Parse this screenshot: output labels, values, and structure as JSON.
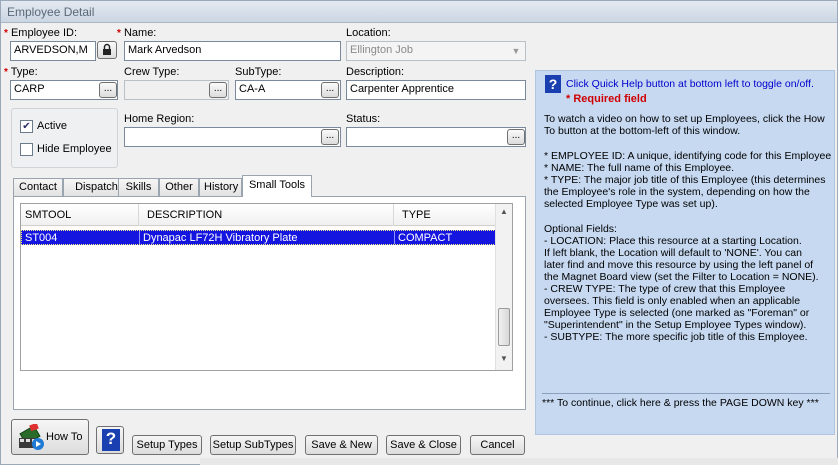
{
  "window": {
    "title": "Employee Detail"
  },
  "form": {
    "employee_id": {
      "label": "Employee ID:",
      "value": "ARVEDSON,M"
    },
    "name": {
      "label": "Name:",
      "value": "Mark Arvedson"
    },
    "location": {
      "label": "Location:",
      "value": "Ellington Job"
    },
    "type": {
      "label": "Type:",
      "value": "CARP"
    },
    "crew_type": {
      "label": "Crew Type:",
      "value": ""
    },
    "subtype": {
      "label": "SubType:",
      "value": "CA-A"
    },
    "description": {
      "label": "Description:",
      "value": "Carpenter Apprentice"
    },
    "home_region": {
      "label": "Home Region:",
      "value": ""
    },
    "status": {
      "label": "Status:",
      "value": ""
    },
    "active": {
      "label": "Active",
      "checked": true
    },
    "hide_employee": {
      "label": "Hide Employee",
      "checked": false
    },
    "required_marker": "*",
    "ellipsis_label": "..."
  },
  "tabs": [
    {
      "label": "Contact"
    },
    {
      "label": "Dispatch"
    },
    {
      "label": "Skills"
    },
    {
      "label": "Other"
    },
    {
      "label": "History"
    },
    {
      "label": "Small Tools",
      "active": true
    }
  ],
  "small_tools": {
    "columns": [
      "SMTOOL",
      "DESCRIPTION",
      "TYPE"
    ],
    "rows": [
      {
        "smtool": "ST004",
        "description": "Dynapac LF72H Vibratory Plate",
        "type": "COMPACT",
        "selected": true
      }
    ]
  },
  "help": {
    "lines": [
      "Click Quick Help button at bottom left to toggle on/off.",
      "*  Required field",
      "To watch a video on how to set up Employees, click the How",
      "To button at the bottom-left of this window.",
      "* EMPLOYEE ID: A unique, identifying code for this Employee",
      "* NAME: The full name of this Employee.",
      "* TYPE: The major job title of this Employee (this determines",
      "   the Employee's role in the system, depending on how the",
      "   selected Employee Type was set up).",
      "Optional Fields:",
      "- LOCATION: Place this resource at a starting Location.",
      "   If left blank, the Location will default to 'NONE'. You can",
      "   later find and move this resource by using the left panel of",
      "   the Magnet Board view (set the Filter to Location = NONE).",
      "- CREW TYPE: The type of crew that this Employee",
      "   oversees. This field is only enabled when an applicable",
      "   Employee Type is selected (one marked as \"Foreman\" or",
      "   \"Superintendent\" in the Setup Employee Types window).",
      "- SUBTYPE: The more specific job title of this Employee.",
      "*** To continue, click here & press the PAGE DOWN key ***"
    ]
  },
  "buttons": {
    "how_to": "How To",
    "help": "?",
    "setup_types": "Setup Types",
    "setup_subtypes": "Setup SubTypes",
    "save_new": "Save & New",
    "save_close": "Save & Close",
    "cancel": "Cancel"
  },
  "colors": {
    "help_panel": "#c6d9f1",
    "selection": "#1515e0",
    "required": "#d00000",
    "help_title": "#0000cc"
  }
}
